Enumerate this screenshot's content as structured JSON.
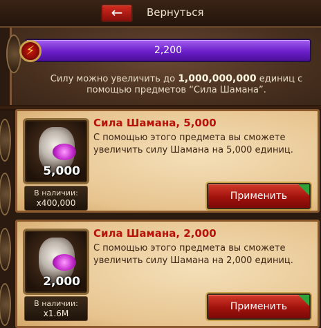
{
  "topbar": {
    "back_icon": "arrow-left-icon",
    "back_label": "Вернуться"
  },
  "power": {
    "emblem_icon": "lightning-emblem-icon",
    "value": "2,200",
    "info_line1_pre": "Силу можно увеличить до",
    "info_line1_value": "1,000,000,000",
    "info_line1_post": "единиц с",
    "info_line2": "помощью предметов “Сила Шамана”."
  },
  "cards": [
    {
      "title": "Сила Шамана, 5,000",
      "desc": "С помощью этого предмета вы сможете увеличить силу Шамана на 5,000 единиц.",
      "item_qty": "5,000",
      "stock_label": "В наличии:",
      "stock_count": "x400,000",
      "apply_label": "Применить"
    },
    {
      "title": "Сила Шамана, 2,000",
      "desc": "С помощью этого предмета вы сможете увеличить силу Шамана на 2,000 единиц.",
      "item_qty": "2,000",
      "stock_label": "В наличии:",
      "stock_count": "x1.6M",
      "apply_label": "Применить"
    }
  ],
  "colors": {
    "power_bar": "#6b1ec9",
    "card_title": "#b8130a",
    "apply_button": "#a1120c",
    "badge_green": "#2fa23a"
  }
}
